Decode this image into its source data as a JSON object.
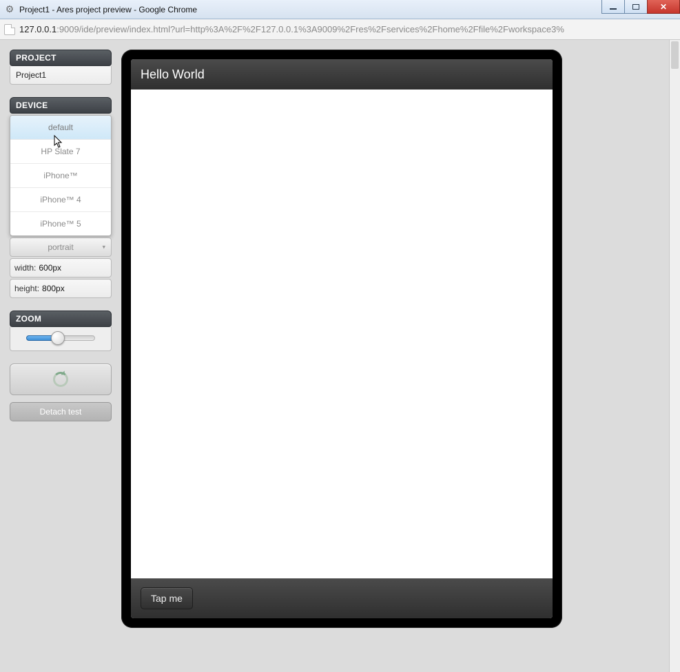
{
  "window": {
    "title": "Project1 - Ares project preview - Google Chrome"
  },
  "address": {
    "host": "127.0.0.1",
    "path": ":9009/ide/preview/index.html?url=http%3A%2F%2F127.0.0.1%3A9009%2Fres%2Fservices%2Fhome%2Ffile%2Fworkspace3%"
  },
  "sidebar": {
    "project": {
      "header": "PROJECT",
      "value": "Project1"
    },
    "device": {
      "header": "DEVICE",
      "options": [
        "default",
        "HP Slate 7",
        "iPhone™",
        "iPhone™ 4",
        "iPhone™ 5"
      ],
      "selected_index": 0,
      "orientation": "portrait",
      "width_label": "width:",
      "width_value": "600px",
      "height_label": "height:",
      "height_value": "800px"
    },
    "zoom": {
      "header": "ZOOM"
    },
    "detach_label": "Detach test"
  },
  "preview": {
    "header_title": "Hello World",
    "footer_button": "Tap me"
  }
}
